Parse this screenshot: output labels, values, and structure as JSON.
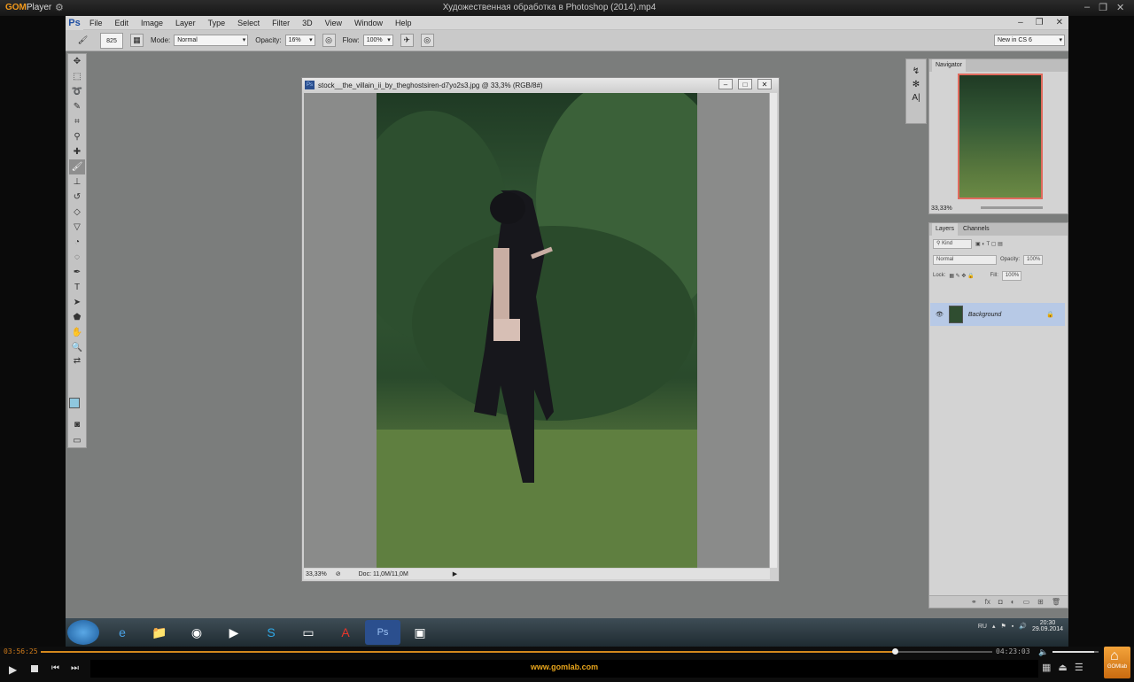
{
  "player": {
    "brand_gom": "GOM",
    "brand_player": "Player",
    "title": "Художественная обработка в Photoshop (2014).mp4",
    "time_current": "03:56:25",
    "time_total": "04:23:03",
    "progress": 0.898,
    "volume": 0.9,
    "url": "www.gomlab.com",
    "gomlab_label": "GOMlab"
  },
  "ps": {
    "logo": "Ps",
    "menu": [
      "File",
      "Edit",
      "Image",
      "Layer",
      "Type",
      "Select",
      "Filter",
      "3D",
      "View",
      "Window",
      "Help"
    ],
    "options": {
      "brush_size": "825",
      "mode_label": "Mode:",
      "mode_value": "Normal",
      "opacity_label": "Opacity:",
      "opacity_value": "16%",
      "flow_label": "Flow:",
      "flow_value": "100%",
      "workspace": "New in CS 6"
    },
    "document": {
      "title": "stock__the_villain_ii_by_theghostsiren-d7yo2s3.jpg @ 33,3% (RGB/8#)",
      "zoom": "33,33%",
      "doc_info": "Doc: 11,0M/11,0M"
    },
    "navigator": {
      "tab": "Navigator",
      "zoom": "33,33%"
    },
    "layers": {
      "tabs": [
        "Layers",
        "Channels"
      ],
      "kind": "Kind",
      "blend": "Normal",
      "opacity_label": "Opacity:",
      "opacity_value": "100%",
      "lock_label": "Lock:",
      "fill_label": "Fill:",
      "fill_value": "100%",
      "layer_name": "Background"
    }
  },
  "taskbar": {
    "lang": "RU",
    "time": "20:30",
    "date": "29.09.2014"
  }
}
